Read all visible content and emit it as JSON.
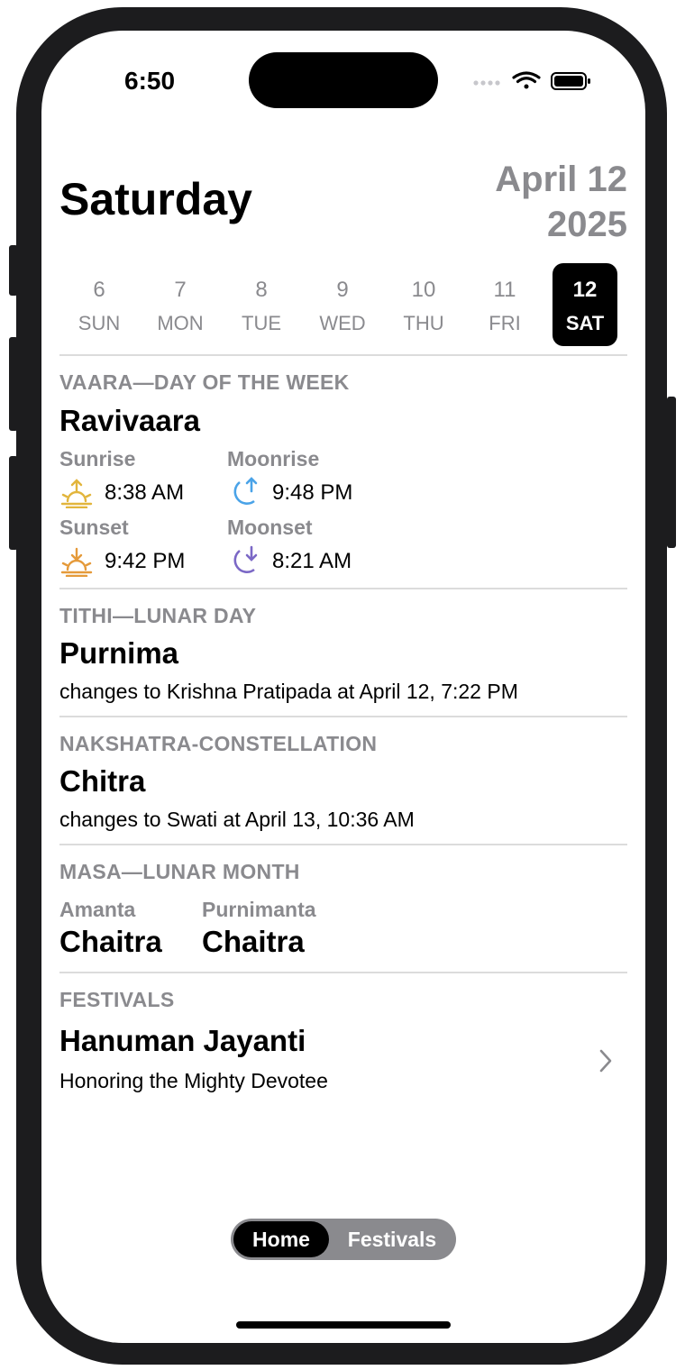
{
  "status_bar": {
    "time": "6:50"
  },
  "header": {
    "day": "Saturday",
    "date_line1": "April 12",
    "date_line2": "2025"
  },
  "week": [
    {
      "num": "6",
      "label": "SUN",
      "selected": false
    },
    {
      "num": "7",
      "label": "MON",
      "selected": false
    },
    {
      "num": "8",
      "label": "TUE",
      "selected": false
    },
    {
      "num": "9",
      "label": "WED",
      "selected": false
    },
    {
      "num": "10",
      "label": "THU",
      "selected": false
    },
    {
      "num": "11",
      "label": "FRI",
      "selected": false
    },
    {
      "num": "12",
      "label": "SAT",
      "selected": true
    }
  ],
  "vaara": {
    "label": "VAARA—DAY OF THE WEEK",
    "title": "Ravivaara",
    "sunrise_label": "Sunrise",
    "sunrise_time": "8:38 AM",
    "moonrise_label": "Moonrise",
    "moonrise_time": "9:48 PM",
    "sunset_label": "Sunset",
    "sunset_time": "9:42 PM",
    "moonset_label": "Moonset",
    "moonset_time": "8:21 AM"
  },
  "tithi": {
    "label": "TITHI—LUNAR DAY",
    "title": "Purnima",
    "subtitle": "changes to Krishna Pratipada at April 12, 7:22 PM"
  },
  "nakshatra": {
    "label": "NAKSHATRA-CONSTELLATION",
    "title": "Chitra",
    "subtitle": "changes to Swati at April 13, 10:36 AM"
  },
  "masa": {
    "label": "MASA—LUNAR MONTH",
    "amanta_label": "Amanta",
    "amanta_value": "Chaitra",
    "purnimanta_label": "Purnimanta",
    "purnimanta_value": "Chaitra"
  },
  "festivals": {
    "label": "FESTIVALS",
    "title": "Hanuman Jayanti",
    "subtitle": "Honoring the Mighty Devotee"
  },
  "tabs": {
    "home": "Home",
    "festivals": "Festivals",
    "selected": "home"
  },
  "colors": {
    "sunrise": "#e2b53c",
    "sunset": "#e59a3a",
    "moonrise": "#4aa3e8",
    "moonset": "#7b68c6",
    "secondary_text": "#8a8a8e"
  }
}
